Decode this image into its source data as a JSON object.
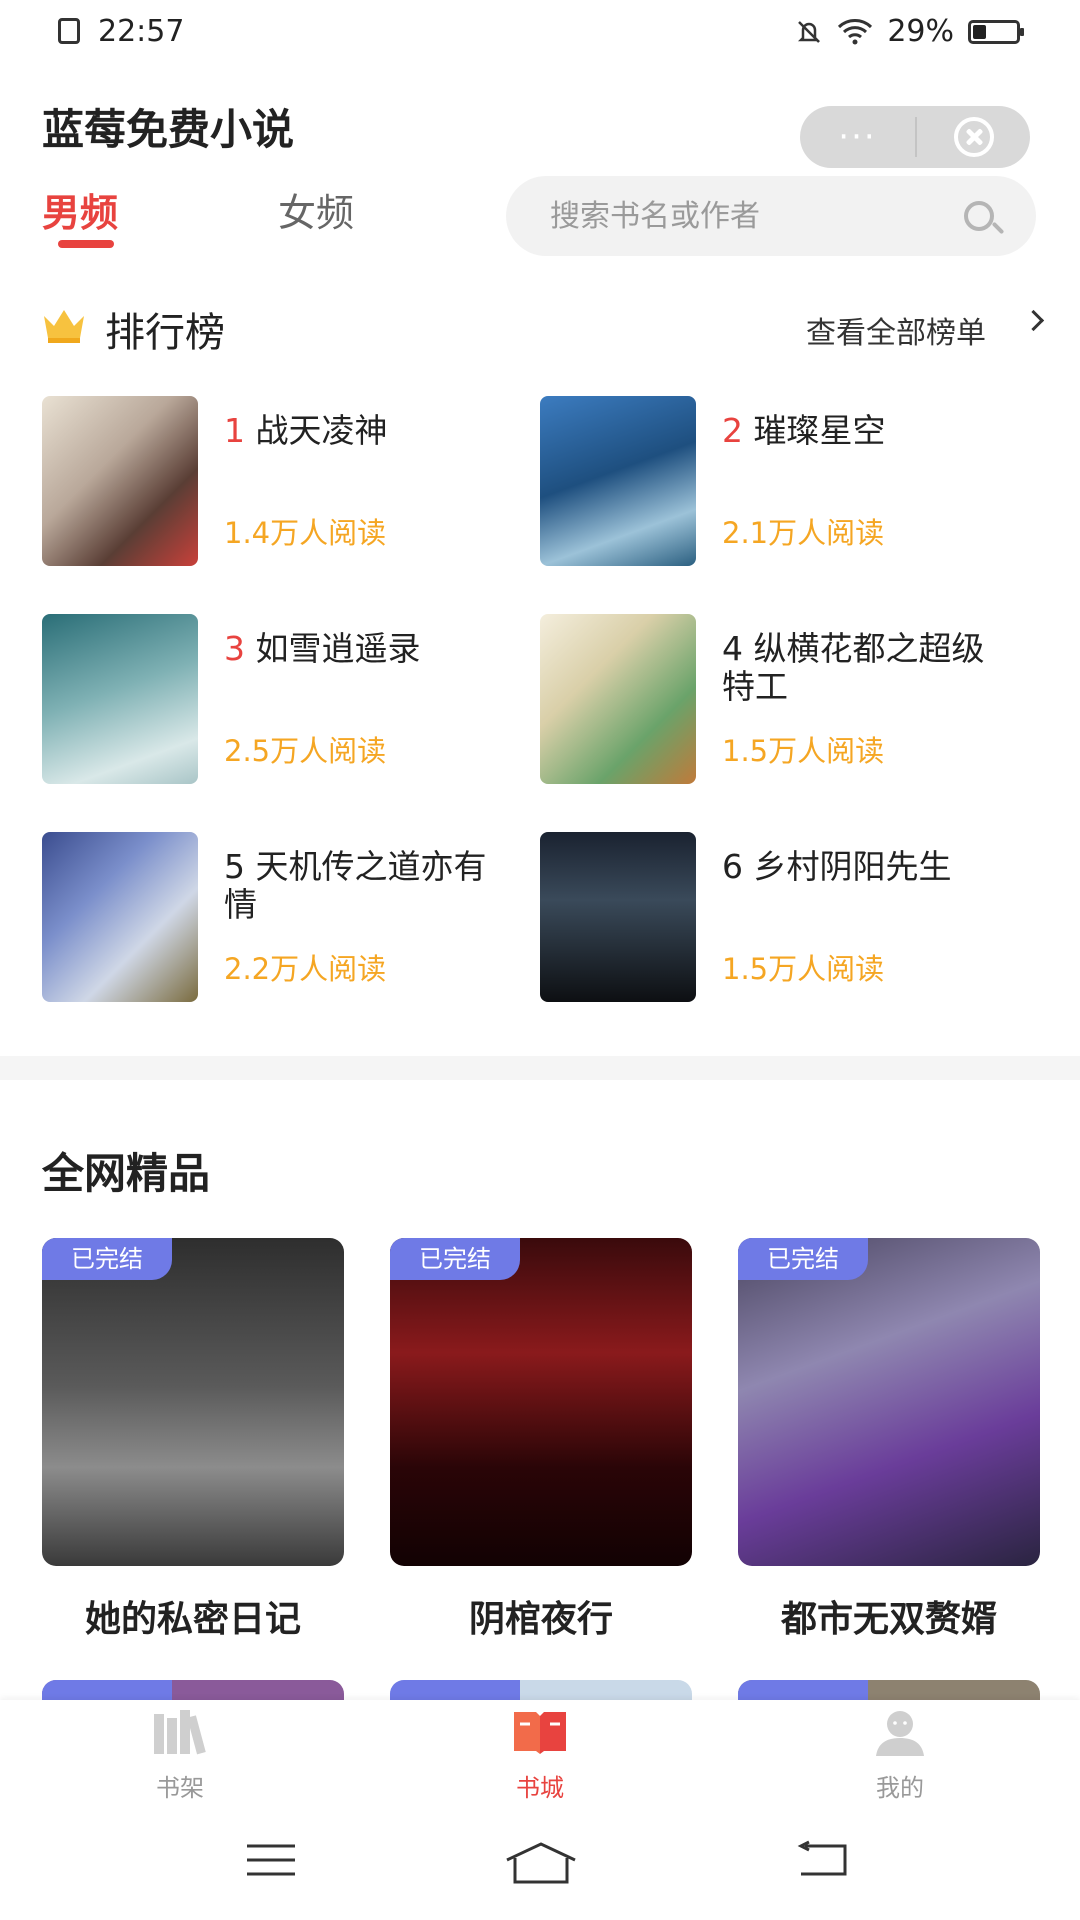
{
  "status": {
    "time": "22:57",
    "battery": "29%",
    "battery_level": 0.29
  },
  "header": {
    "app_title": "蓝莓免费小说",
    "capsule_more": "···",
    "tabs": [
      "男频",
      "女频"
    ],
    "active_tab": "男频",
    "search_placeholder": "搜索书名或作者"
  },
  "ranking": {
    "title": "排行榜",
    "view_all": "查看全部榜单",
    "items": [
      {
        "rank": "1",
        "title": "战天凌神",
        "reads": "1.4万人阅读"
      },
      {
        "rank": "2",
        "title": "璀璨星空",
        "reads": "2.1万人阅读"
      },
      {
        "rank": "3",
        "title": "如雪逍遥录",
        "reads": "2.5万人阅读"
      },
      {
        "rank": "4",
        "title": "纵横花都之超级特工",
        "reads": "1.5万人阅读"
      },
      {
        "rank": "5",
        "title": "天机传之道亦有情",
        "reads": "2.2万人阅读"
      },
      {
        "rank": "6",
        "title": "乡村阴阳先生",
        "reads": "1.5万人阅读"
      }
    ]
  },
  "premium": {
    "title": "全网精品",
    "books": [
      {
        "badge": "已完结",
        "title": "她的私密日记"
      },
      {
        "badge": "已完结",
        "title": "阴棺夜行"
      },
      {
        "badge": "已完结",
        "title": "都市无双赘婿"
      }
    ]
  },
  "bottom_nav": [
    {
      "label": "书架",
      "icon": "bookshelf-icon",
      "active": false
    },
    {
      "label": "书城",
      "icon": "book-store-icon",
      "active": true
    },
    {
      "label": "我的",
      "icon": "profile-icon",
      "active": false
    }
  ],
  "colors": {
    "accent": "#e8433f",
    "reads": "#f5a623",
    "badge": "#6f7ae6"
  }
}
